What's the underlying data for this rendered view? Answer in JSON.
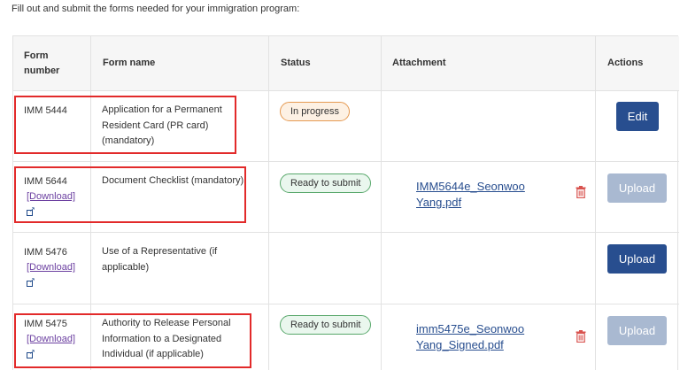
{
  "intro": "Fill out and submit the forms needed for your immigration program:",
  "headers": {
    "form_number": "Form number",
    "form_name": "Form name",
    "status": "Status",
    "attachment": "Attachment",
    "actions": "Actions"
  },
  "rows": [
    {
      "number": "IMM 5444",
      "name": "Application for a Permanent Resident Card (PR card) (mandatory)",
      "status": "In progress",
      "attachment": "",
      "action": "Edit",
      "action_disabled": false
    },
    {
      "number": "IMM 5644",
      "download": "[Download]",
      "name": "Document Checklist (mandatory)",
      "status": "Ready to submit",
      "attachment": "IMM5644e_Seonwoo Yang.pdf",
      "action": "Upload",
      "action_disabled": true
    },
    {
      "number": "IMM 5476",
      "download": "[Download]",
      "name": "Use of a Representative (if applicable)",
      "status": "",
      "attachment": "",
      "action": "Upload",
      "action_disabled": false
    },
    {
      "number": "IMM 5475",
      "download": "[Download]",
      "name": "Authority to Release Personal Information to a Designated Individual (if applicable)",
      "status": "Ready to submit",
      "attachment": "imm5475e_Seonwoo Yang_Signed.pdf",
      "action": "Upload",
      "action_disabled": true
    }
  ],
  "colors": {
    "primary_button": "#284e8f",
    "disabled_button": "#a9b9d1",
    "highlight": "#e22a2a",
    "link": "#284e8f",
    "visited_link": "#6b3fa0",
    "trash": "#d9534f"
  }
}
